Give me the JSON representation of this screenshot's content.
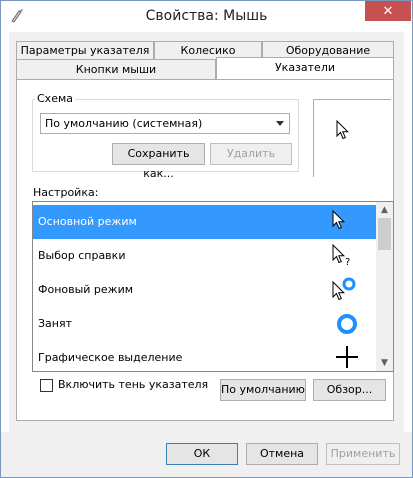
{
  "window": {
    "title": "Свойства: Мышь",
    "close_symbol": "✕"
  },
  "tabs": {
    "row_back": [
      "Параметры указателя",
      "Колесико",
      "Оборудование"
    ],
    "row_front": [
      "Кнопки мыши",
      "Указатели"
    ],
    "active": "Указатели"
  },
  "scheme": {
    "group_label": "Схема",
    "selected": "По умолчанию (системная)",
    "save_label": "Сохранить как...",
    "delete_label": "Удалить"
  },
  "customize": {
    "label": "Настройка:",
    "items": [
      {
        "label": "Основной режим",
        "icon": "arrow-cursor-icon",
        "selected": true
      },
      {
        "label": "Выбор справки",
        "icon": "help-cursor-icon",
        "selected": false
      },
      {
        "label": "Фоновый режим",
        "icon": "working-in-background-cursor-icon",
        "selected": false
      },
      {
        "label": "Занят",
        "icon": "busy-cursor-icon",
        "selected": false
      },
      {
        "label": "Графическое выделение",
        "icon": "precision-select-cursor-icon",
        "selected": false
      }
    ]
  },
  "shadow": {
    "label": "Включить тень указателя",
    "checked": false
  },
  "buttons": {
    "default_label": "По умолчанию",
    "browse_label": "Обзор...",
    "ok_label": "ОК",
    "cancel_label": "Отмена",
    "apply_label": "Применить"
  },
  "colors": {
    "selection": "#3399ff",
    "close": "#c75050",
    "busy_ring": "#1e90ff"
  }
}
